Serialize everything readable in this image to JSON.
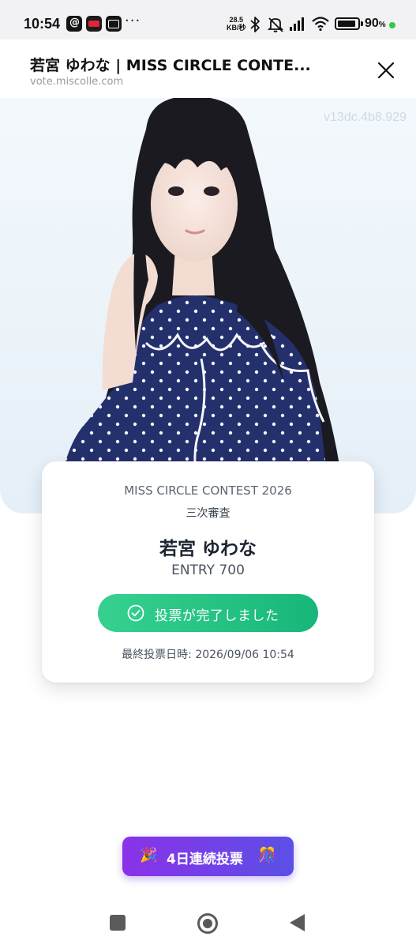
{
  "status_bar": {
    "time": "10:54",
    "more": "···",
    "net_speed_value": "28.5",
    "net_speed_unit": "KB/秒",
    "battery_percent": "90",
    "battery_percent_sign": "%",
    "battery_level": 0.9,
    "icons": [
      "threads-icon",
      "app-red-icon",
      "app-box-icon",
      "bluetooth-icon",
      "mute-icon",
      "signal-icon",
      "wifi-icon",
      "battery-icon"
    ]
  },
  "browser": {
    "title": "若宮 ゆわな | MISS CIRCLE CONTE...",
    "url": "vote.miscolle.com",
    "close_icon": "close-icon"
  },
  "hero": {
    "watermark": "v13dc.4b8.929"
  },
  "card": {
    "contest": "MISS CIRCLE CONTEST 2026",
    "round": "三次審査",
    "name": "若宮 ゆわな",
    "entry": "ENTRY 700",
    "vote_status": "投票が完了しました",
    "last_vote": "最終投票日時: 2026/09/06 10:54"
  },
  "streak": {
    "label": "4日連続投票",
    "emoji_left": "🎉",
    "emoji_right": "🎊"
  },
  "colors": {
    "accent_green": "#1fbf80",
    "streak_purple": "#7a3be6",
    "dress_navy": "#23306b"
  }
}
